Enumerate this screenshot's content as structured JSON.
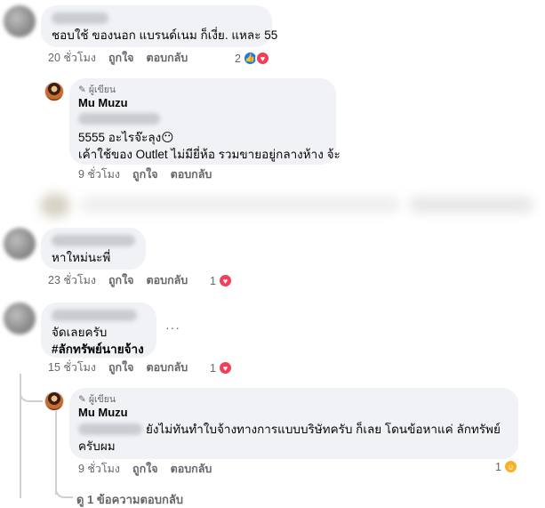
{
  "comments": [
    {
      "text": "ชอบใช้ ของนอก แบรนด์เนม ก็เงี่ย. แหละ 55",
      "time": "20 ชั่วโมง",
      "like": "ถูกใจ",
      "reply": "ตอบกลับ",
      "reaction_count": "2",
      "reaction_icons": [
        "like-icon",
        "love-icon"
      ]
    },
    {
      "badge": "ผู้เขียน",
      "author": "Mu Muzu",
      "lines": [
        "5555 อะไรจ๊ะลุง😶",
        "เค้าใช้ของ Outlet ไม่มียี่ห้อ รวมขายอยู่กลางห้าง จ้ะ"
      ],
      "time": "9 ชั่วโมง",
      "like": "ถูกใจ",
      "reply": "ตอบกลับ"
    },
    {
      "text": "หาใหม่นะพี่",
      "time": "23 ชั่วโมง",
      "like": "ถูกใจ",
      "reply": "ตอบกลับ",
      "reaction_count": "1",
      "reaction_icons": [
        "love-icon"
      ]
    },
    {
      "lines": [
        "จัดเลยครับ",
        "#ลักทรัพย์นายจ้าง"
      ],
      "more": "···",
      "time": "15 ชั่วโมง",
      "like": "ถูกใจ",
      "reply": "ตอบกลับ",
      "reaction_count": "1",
      "reaction_icons": [
        "love-icon"
      ]
    },
    {
      "badge": "ผู้เขียน",
      "author": "Mu Muzu",
      "lines": [
        "ยังไม่ทันทำใบจ้างทางการแบบบริษัทครับ ก็เลย โดนข้อหาแค่ ลักทรัพย์",
        "ครับผม"
      ],
      "time": "9 ชั่วโมง",
      "like": "ถูกใจ",
      "reply": "ตอบกลับ",
      "reaction_count": "1",
      "reaction_icons": [
        "care-icon"
      ]
    }
  ],
  "view_replies": "ดู 1 ข้อความตอบกลับ",
  "colors": {
    "bubble": "#f0f2f5",
    "meta": "#65676b",
    "like": "#1877f2",
    "love": "#f33e58"
  }
}
